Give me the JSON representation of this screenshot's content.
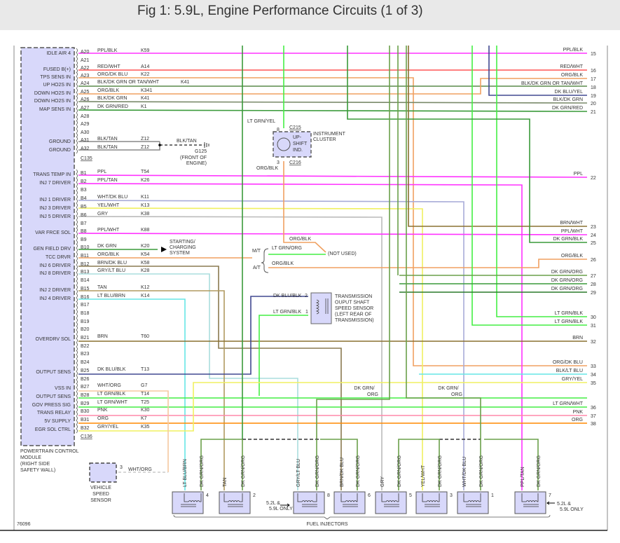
{
  "title": "Fig 1: 5.9L, Engine Performance Circuits (1 of 3)",
  "pcm": {
    "name_lines": [
      "POWERTRAIN CONTROL",
      "MODULE",
      "(RIGHT SIDE",
      "SAFETY WALL)"
    ],
    "connector_a": "C135",
    "connector_b": "C136",
    "pins": [
      [
        "A20",
        "IDLE AIR 4",
        "PPL/BLK",
        "K59"
      ],
      [
        "A21",
        "",
        "",
        ""
      ],
      [
        "A22",
        "FUSED B(+)",
        "RED/WHT",
        "A14"
      ],
      [
        "A23",
        "TPS SENS IN",
        "ORG/DK BLU",
        "K22"
      ],
      [
        "A24",
        "UP HO2S IN",
        "BLK/DK GRN OR TAN/WHT",
        "K41"
      ],
      [
        "A25",
        "DOWN HO2S IN",
        "ORG/BLK",
        "K341"
      ],
      [
        "A26",
        "DOWN HO2S IN",
        "BLK/DK GRN",
        "K41"
      ],
      [
        "A27",
        "MAP SENS IN",
        "DK GRN/RED",
        "K1"
      ],
      [
        "A28",
        "",
        "",
        ""
      ],
      [
        "A29",
        "",
        "",
        ""
      ],
      [
        "A30",
        "",
        "",
        ""
      ],
      [
        "A31",
        "GROUND",
        "BLK/TAN",
        "Z12"
      ],
      [
        "A32",
        "GROUND",
        "BLK/TAN",
        "Z12"
      ],
      [
        "B1",
        "TRANS TEMP IN",
        "PPL",
        "T54"
      ],
      [
        "B2",
        "INJ 7 DRIVER",
        "PPL/TAN",
        "K26"
      ],
      [
        "B3",
        "",
        "",
        ""
      ],
      [
        "B4",
        "INJ 1 DRIVER",
        "WHT/DK BLU",
        "K11"
      ],
      [
        "B5",
        "INJ 3 DRIVER",
        "YEL/WHT",
        "K13"
      ],
      [
        "B6",
        "INJ 5 DRIVER",
        "GRY",
        "K38"
      ],
      [
        "B7",
        "",
        "",
        ""
      ],
      [
        "B8",
        "VAR FRCE SOL",
        "PPL/WHT",
        "K88"
      ],
      [
        "B9",
        "",
        "",
        ""
      ],
      [
        "B10",
        "GEN FIELD DRV",
        "DK GRN",
        "K20"
      ],
      [
        "B11",
        "TCC DRVR",
        "ORG/BLK",
        "K54"
      ],
      [
        "B12",
        "INJ 6 DRIVER",
        "BRN/DK BLU",
        "K58"
      ],
      [
        "B13",
        "INJ 8 DRIVER",
        "GRY/LT BLU",
        "K28"
      ],
      [
        "B14",
        "",
        "",
        ""
      ],
      [
        "B15",
        "INJ 2 DRIVER",
        "TAN",
        "K12"
      ],
      [
        "B16",
        "INJ 4 DRIVER",
        "LT BLU/BRN",
        "K14"
      ],
      [
        "B17",
        "",
        "",
        ""
      ],
      [
        "B18",
        "",
        "",
        ""
      ],
      [
        "B19",
        "",
        "",
        ""
      ],
      [
        "B20",
        "",
        "",
        ""
      ],
      [
        "B21",
        "OVERDRV SOL",
        "BRN",
        "T60"
      ],
      [
        "B22",
        "",
        "",
        ""
      ],
      [
        "B23",
        "",
        "",
        ""
      ],
      [
        "B24",
        "",
        "",
        ""
      ],
      [
        "B25",
        "OUTPUT SENS",
        "DK BLU/BLK",
        "T13"
      ],
      [
        "B26",
        "",
        "",
        ""
      ],
      [
        "B27",
        "VSS IN",
        "WHT/ORG",
        "G7"
      ],
      [
        "B28",
        "OUTPUT SENS",
        "LT GRN/BLK",
        "T14"
      ],
      [
        "B29",
        "GOV PRESS SIG",
        "LT GRN/WHT",
        "T25"
      ],
      [
        "B30",
        "TRANS RELAY",
        "PNK",
        "K30"
      ],
      [
        "B31",
        "5V SUPPLY",
        "ORG",
        "K7"
      ],
      [
        "B32",
        "EGR SOL CTRL",
        "GRY/YEL",
        "K35"
      ]
    ]
  },
  "terminals": [
    [
      "15",
      "PPL/BLK"
    ],
    [
      "16",
      "RED/WHT"
    ],
    [
      "17",
      "ORG/BLK"
    ],
    [
      "18",
      "BLK/DK GRN OR TAN/WHT"
    ],
    [
      "19",
      "DK BLU/YEL"
    ],
    [
      "20",
      "BLK/DK GRN"
    ],
    [
      "21",
      "DK GRN/RED"
    ],
    [
      "22",
      "PPL"
    ],
    [
      "23",
      "BRN/WHT"
    ],
    [
      "24",
      "PPL/WHT"
    ],
    [
      "25",
      "DK GRN/BLK"
    ],
    [
      "26",
      "ORG/BLK"
    ],
    [
      "27",
      "DK GRN/ORG"
    ],
    [
      "28",
      "DK GRN/ORG"
    ],
    [
      "29",
      "DK GRN/ORG"
    ],
    [
      "30",
      "LT GRN/BLK"
    ],
    [
      "31",
      "LT GRN/BLK"
    ],
    [
      "32",
      "BRN"
    ],
    [
      "33",
      "ORG/DK BLU"
    ],
    [
      "34",
      "BLK/LT BLU"
    ],
    [
      "35",
      "GRY/YEL"
    ],
    [
      "36",
      "LT GRN/WHT"
    ],
    [
      "37",
      "PNK"
    ],
    [
      "38",
      "ORG"
    ]
  ],
  "ground": {
    "wire": "BLK/TAN",
    "id": "G125",
    "loc_lines": [
      "(FRONT OF",
      "ENGINE)"
    ]
  },
  "charging": {
    "lines": [
      "STARTING/",
      "CHARGING",
      "SYSTEM"
    ]
  },
  "cluster": {
    "wire_in": "LT GRN/YEL",
    "pin_in": "8",
    "conn_in": "C215",
    "pin_out": "3",
    "conn_out": "C216",
    "wire_out": "ORG/BLK",
    "ind_lines": [
      "UP-",
      "SHIFT",
      "IND."
    ],
    "name_lines": [
      "INSTRUMENT",
      "CLUSTER"
    ]
  },
  "tcc": {
    "wire_top": "ORG/BLK",
    "mt": "M/T",
    "at": "A/T",
    "mt_wire": "LT GRN/ORG",
    "at_wire": "ORG/BLK",
    "not_used": "(NOT USED)"
  },
  "oss": {
    "wire2": "DK BLU/BLK",
    "pin2": "2",
    "wire1": "LT GRN/BLK",
    "pin1": "1",
    "name_lines": [
      "TRANSMISSION",
      "OUPUT SHAFT",
      "SPEED SENSOR",
      "(LEFT REAR OF",
      "TRANSMISSION)"
    ]
  },
  "vss": {
    "pin": "3",
    "wire": "WHT/ORG",
    "name_lines": [
      "VEHICLE",
      "SPEED",
      "SENSOR"
    ]
  },
  "bus_labels": [
    [
      "DK GRN/",
      "ORG"
    ],
    [
      "DK GRN/",
      "ORG"
    ]
  ],
  "injectors": [
    {
      "num": "4",
      "drv": "LT BLU/BRN",
      "pwr": "DK GRN/ORG"
    },
    {
      "num": "2",
      "drv": "TAN",
      "pwr": "DK GRN/ORG"
    },
    {
      "num": "8",
      "drv": "GRY/LT BLU",
      "pwr": "DK GRN/ORG"
    },
    {
      "num": "6",
      "drv": "BRN/DK BLU",
      "pwr": "DK GRN/ORG"
    },
    {
      "num": "5",
      "drv": "GRY",
      "pwr": "DK GRN/ORG"
    },
    {
      "num": "3",
      "drv": "YEL/WHT",
      "pwr": "DK GRN/ORG"
    },
    {
      "num": "1",
      "drv": "WHT/DK BLU",
      "pwr": "DK GRN/ORG"
    },
    {
      "num": "7",
      "drv": "PPL/TAN",
      "pwr": "DK GRN/ORG"
    }
  ],
  "only_note": [
    "5.2L &",
    "5.9L ONLY"
  ],
  "injectors_label": "FUEL INJECTORS",
  "fig_id": "76096",
  "colors": {
    "pcm_fill": "#d8d8fa",
    "ppl": "#ff33ff",
    "red": "#ff5555",
    "org": "#f0a060",
    "dkgrn": "#3a9a3a",
    "ltgrn": "#44ee44",
    "brn": "#8a7030",
    "dkblu": "#404890",
    "cyan": "#66e6e6",
    "gry": "#bbbbbb",
    "yel": "#f0f060",
    "pnk": "#ff88aa"
  }
}
